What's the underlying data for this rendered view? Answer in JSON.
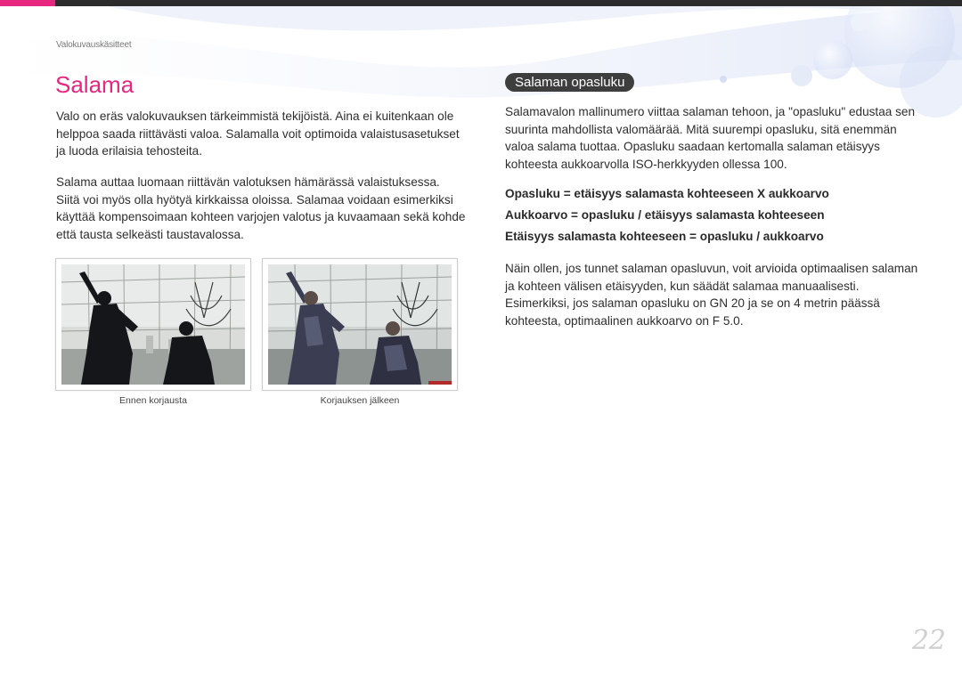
{
  "header": {
    "breadcrumb": "Valokuvauskäsitteet"
  },
  "colors": {
    "accent": "#e6267f",
    "topbar": "#2c2c2c",
    "pill": "#3e3e3e"
  },
  "left": {
    "title": "Salama",
    "paragraph1": "Valo on eräs valokuvauksen tärkeimmistä tekijöistä. Aina ei kuitenkaan ole helppoa saada riittävästi valoa. Salamalla voit optimoida valaistusasetukset ja luoda erilaisia tehosteita.",
    "paragraph2": "Salama auttaa luomaan riittävän valotuksen hämärässä valaistuksessa. Siitä voi myös olla hyötyä kirkkaissa oloissa. Salamaa voidaan esimerkiksi käyttää kompensoimaan kohteen varjojen valotus ja kuvaamaan sekä kohde että tausta selkeästi taustavalossa.",
    "images": [
      {
        "caption": "Ennen korjausta",
        "icon": "photo-statues-backlit"
      },
      {
        "caption": "Korjauksen jälkeen",
        "icon": "photo-statues-flash"
      }
    ]
  },
  "right": {
    "section_title": "Salaman opasluku",
    "paragraph1": "Salamavalon mallinumero viittaa salaman tehoon, ja \"opasluku\" edustaa sen suurinta mahdollista valomäärää. Mitä suurempi opasluku, sitä enemmän valoa salama tuottaa. Opasluku saadaan kertomalla salaman etäisyys kohteesta aukkoarvolla ISO-herkkyyden ollessa 100.",
    "formulas": [
      "Opasluku = etäisyys salamasta kohteeseen X aukkoarvo",
      "Aukkoarvo = opasluku / etäisyys salamasta kohteeseen",
      "Etäisyys salamasta kohteeseen = opasluku / aukkoarvo"
    ],
    "paragraph2": "Näin ollen, jos tunnet salaman opasluvun, voit arvioida optimaalisen salaman ja kohteen välisen etäisyyden, kun säädät salamaa manuaalisesti. Esimerkiksi, jos salaman opasluku on GN 20 ja se on 4 metrin päässä kohteesta, optimaalinen aukkoarvo on F 5.0."
  },
  "footer": {
    "page_number": "22"
  }
}
